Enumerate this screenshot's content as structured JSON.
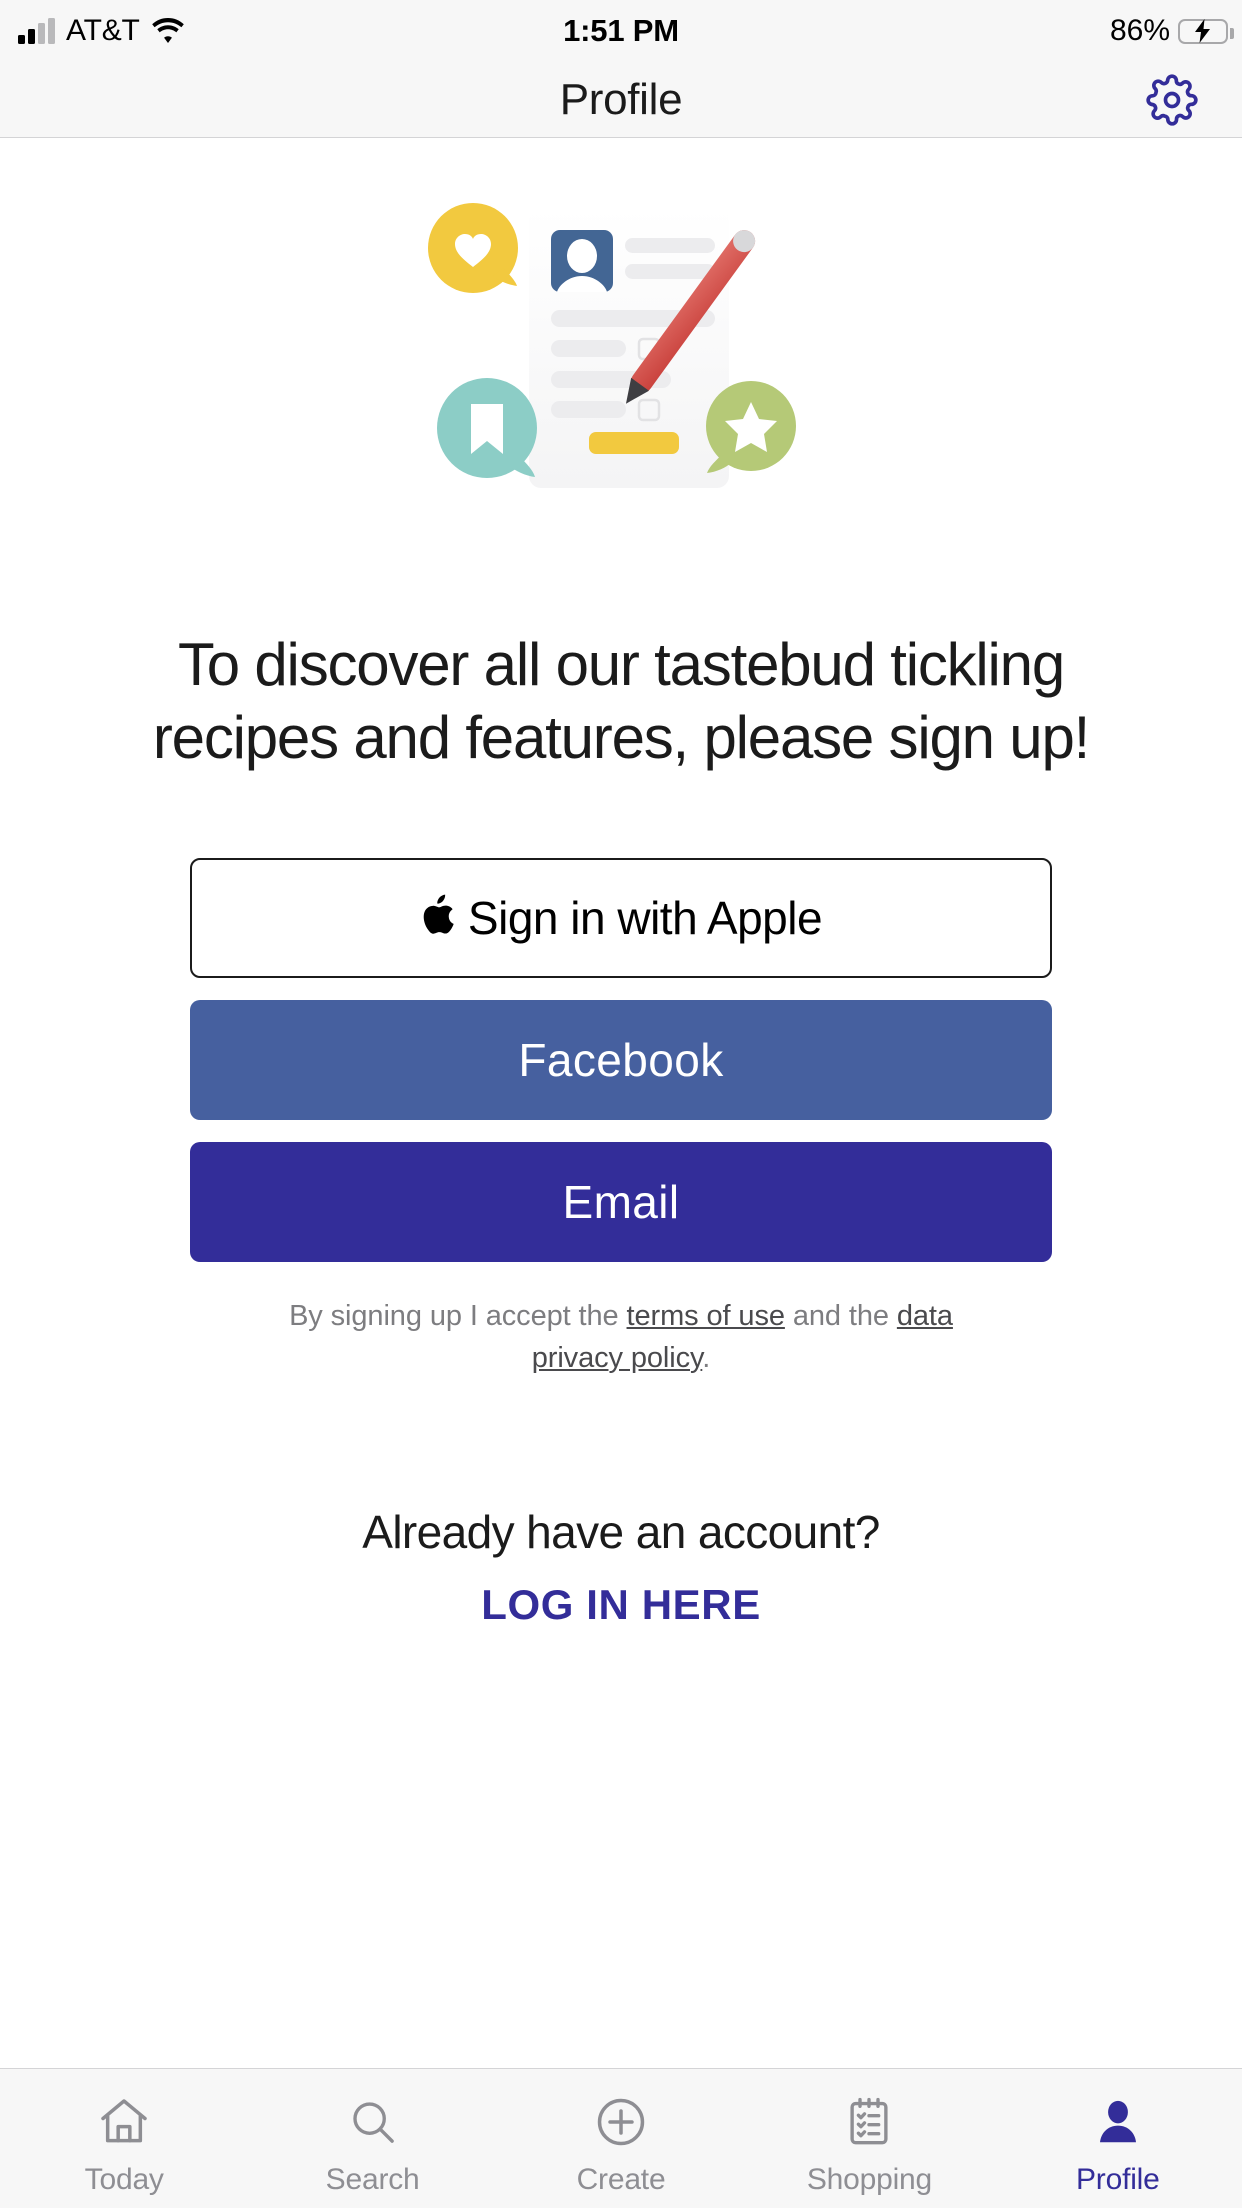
{
  "status_bar": {
    "carrier": "AT&T",
    "time": "1:51 PM",
    "battery_percent": "86%",
    "battery_level": 86,
    "charging": true,
    "wifi_icon": "wifi-icon",
    "signal_icon": "cellular-signal-icon",
    "battery_icon": "battery-charging-icon"
  },
  "navbar": {
    "title": "Profile",
    "settings_icon": "gear-icon"
  },
  "illustration": {
    "name": "profile-signup-illustration",
    "elements": [
      "heart-bubble-icon",
      "profile-card",
      "pencil-icon",
      "bookmark-bubble-icon",
      "star-bubble-icon"
    ],
    "colors": {
      "yellow": "#F5C93F",
      "teal": "#8CCDC6",
      "green": "#B5C977",
      "blue": "#436694",
      "red": "#D9534F",
      "card": "#FBFBFB"
    }
  },
  "headline": "To discover all our tastebud tickling recipes and features, please sign up!",
  "buttons": {
    "apple_label": "Sign in with Apple",
    "apple_icon": "apple-logo-icon",
    "facebook_label": "Facebook",
    "email_label": "Email"
  },
  "legal": {
    "prefix": "By signing up I accept the ",
    "terms_link": "terms of use",
    "middle": " and the ",
    "privacy_link": "data privacy policy",
    "suffix": "."
  },
  "login": {
    "question": "Already have an account?",
    "link_label": "LOG IN HERE"
  },
  "tabbar": {
    "items": [
      {
        "label": "Today",
        "icon": "home-icon",
        "active": false
      },
      {
        "label": "Search",
        "icon": "search-icon",
        "active": false
      },
      {
        "label": "Create",
        "icon": "plus-circle-icon",
        "active": false
      },
      {
        "label": "Shopping",
        "icon": "checklist-icon",
        "active": false
      },
      {
        "label": "Profile",
        "icon": "person-icon",
        "active": true
      }
    ]
  },
  "theme": {
    "accent": "#332D99",
    "facebook_blue": "#46609F",
    "muted_text": "#8E8E93",
    "bar_background": "#F7F7F7"
  }
}
